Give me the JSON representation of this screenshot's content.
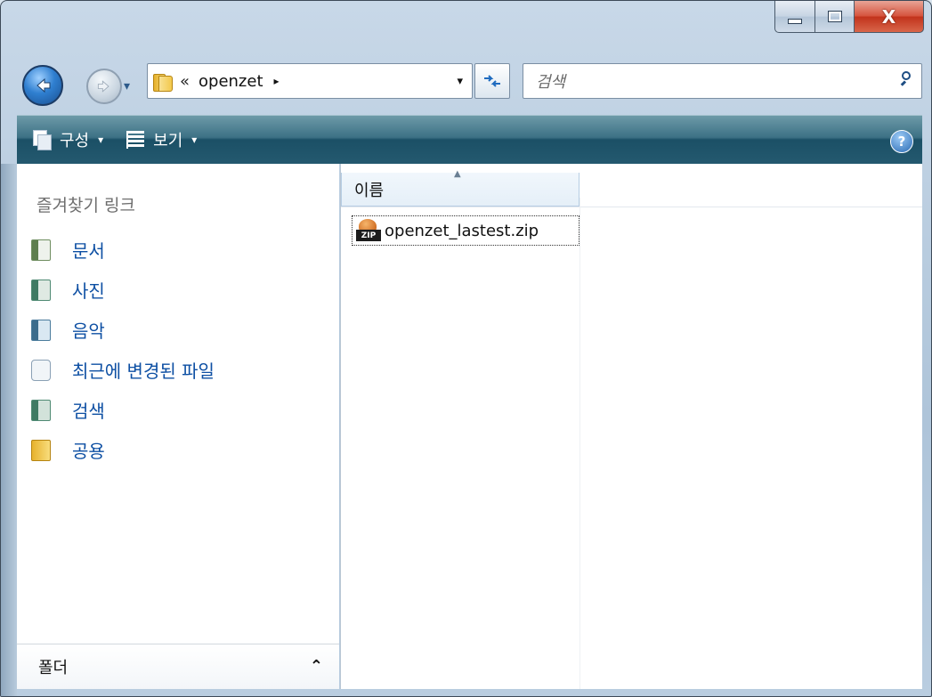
{
  "window": {
    "caption_close": "X"
  },
  "address": {
    "overflow": "«",
    "current_folder": "openzet",
    "crumb_arrow": "▸",
    "dropdown": "▾"
  },
  "search": {
    "placeholder": "검색"
  },
  "toolbar": {
    "organize_label": "구성",
    "views_label": "보기",
    "dropdown": "▾",
    "help": "?"
  },
  "nav_pane": {
    "links_header": "즐겨찾기 링크",
    "items": [
      {
        "label": "문서",
        "icon": "documents-icon"
      },
      {
        "label": "사진",
        "icon": "pictures-icon"
      },
      {
        "label": "음악",
        "icon": "music-icon"
      },
      {
        "label": "최근에 변경된 파일",
        "icon": "recent-files-icon"
      },
      {
        "label": "검색",
        "icon": "searches-icon"
      },
      {
        "label": "공용",
        "icon": "public-folder-icon"
      }
    ],
    "folders_label": "폴더",
    "folders_chevron": "⌃"
  },
  "file_list": {
    "column_name": "이름",
    "sort_indicator": "▲",
    "files": [
      {
        "name": "openzet_lastest.zip",
        "icon_tag": "ZIP"
      }
    ]
  },
  "colors": {
    "accent": "#0d4fa3",
    "toolbar": "#24596f",
    "close": "#c2331c"
  }
}
